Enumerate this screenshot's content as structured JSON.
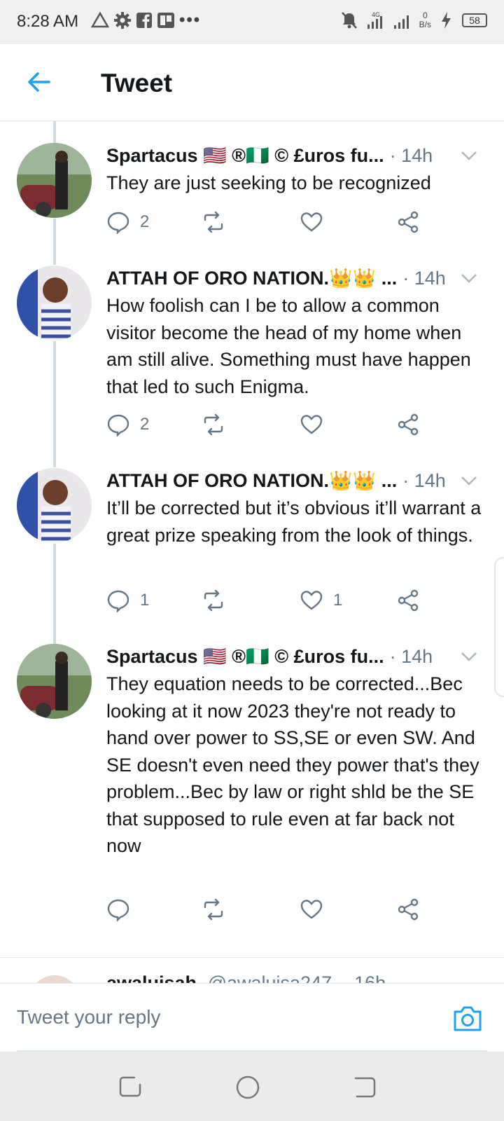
{
  "status_bar": {
    "time": "8:28 AM",
    "network": "4G",
    "speed_value": "0",
    "speed_unit": "B/s",
    "battery": "58"
  },
  "header": {
    "title": "Tweet",
    "back_icon": "back-arrow-icon",
    "accent_color": "#1da1f2"
  },
  "tweets": [
    {
      "name": "Spartacus 🇺🇸 ®🇳🇬 © £uros fu...",
      "time": "· 14h",
      "text": "They are just seeking to be recognized",
      "replies": "2",
      "retweets": "",
      "likes": ""
    },
    {
      "name": "ATTAH OF ORO NATION.👑👑 ...",
      "time": "· 14h",
      "text": "How foolish can I be to allow a common visitor become the head of my home when am still alive. Something must have happen that led to such Enigma.",
      "replies": "2",
      "retweets": "",
      "likes": ""
    },
    {
      "name": "ATTAH OF ORO NATION.👑👑 ...",
      "time": "· 14h",
      "text": "It’ll be corrected but it’s obvious it’ll warrant a great prize speaking from the look of things.",
      "replies": "1",
      "retweets": "",
      "likes": "1"
    },
    {
      "name": "Spartacus 🇺🇸 ®🇳🇬 © £uros fu...",
      "time": "· 14h",
      "text": "They equation needs to be corrected...Bec looking at it now 2023 they're not ready to hand over power to SS,SE or even SW. And SE doesn't even need they power that's they problem...Bec by law or right shld be the SE  that supposed to rule even at far back not now",
      "replies": "",
      "retweets": "",
      "likes": ""
    }
  ],
  "partial_tweet": {
    "name": "awaluisah",
    "handle": "@awaluisa247",
    "time": "· 16h"
  },
  "reply": {
    "placeholder": "Tweet your reply",
    "camera_icon": "camera-icon"
  },
  "nav": {
    "recents_icon": "recents-icon",
    "home_icon": "home-circle-icon",
    "back_icon": "nav-back-icon"
  }
}
